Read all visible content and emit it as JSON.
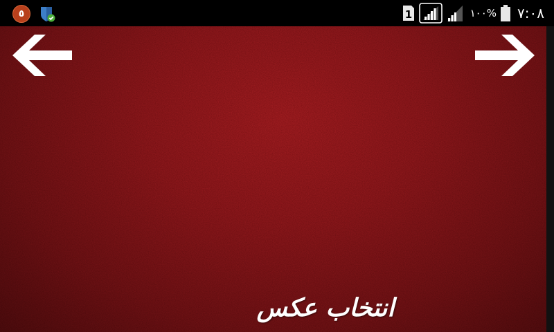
{
  "status_bar": {
    "notification_count": "٥",
    "sim_slot": "1",
    "battery_percent": "١٠٠%",
    "clock": "٧:٠٨",
    "icons": {
      "notification": "notification-count-badge",
      "security": "shield-check-icon",
      "sim": "sim-card-icon",
      "signal_primary": "signal-strength-icon",
      "signal_secondary": "signal-strength-icon",
      "battery": "battery-icon"
    }
  },
  "main": {
    "background_color": "#8c171b",
    "back_icon": "arrow-left-icon",
    "forward_icon": "arrow-right-icon",
    "choose_photo_label": "انتخاب عکس"
  }
}
